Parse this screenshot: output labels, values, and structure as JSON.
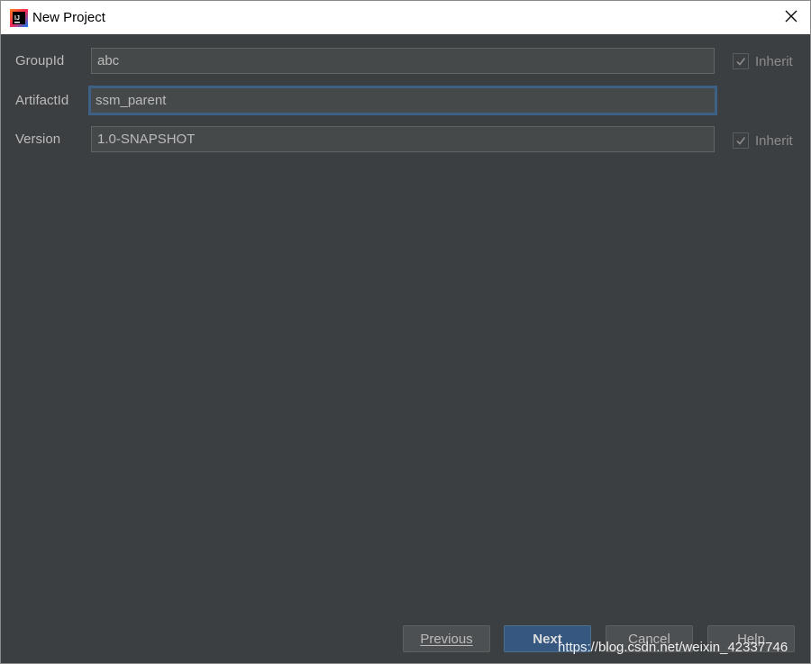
{
  "window": {
    "title": "New Project",
    "app_icon": "intellij-idea-icon",
    "close_icon": "close-icon"
  },
  "form": {
    "group_id": {
      "label": "GroupId",
      "value": "abc",
      "inherit_label": "Inherit",
      "inherit_checked": true
    },
    "artifact_id": {
      "label": "ArtifactId",
      "value": "ssm_parent"
    },
    "version": {
      "label": "Version",
      "value": "1.0-SNAPSHOT",
      "inherit_label": "Inherit",
      "inherit_checked": true
    }
  },
  "buttons": {
    "previous": "Previous",
    "next": "Next",
    "cancel": "Cancel",
    "help": "Help"
  },
  "watermark": "https://blog.csdn.net/weixin_42337746",
  "colors": {
    "background": "#3c3f41",
    "field_bg": "#45494a",
    "focus_border": "#3d6185",
    "primary_button": "#365880",
    "text": "#bbbbbb"
  }
}
